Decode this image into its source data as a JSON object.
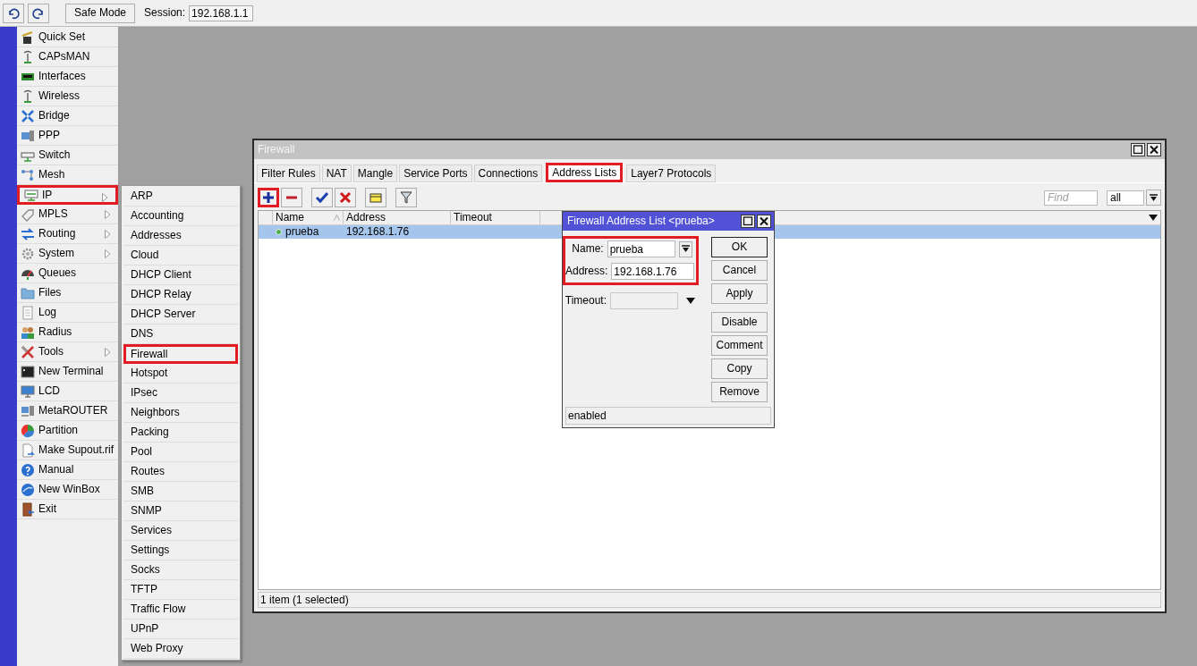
{
  "topbar": {
    "history_buttons": [
      {
        "kind": "undo"
      },
      {
        "kind": "redo"
      }
    ],
    "safe_mode": "Safe Mode",
    "session": {
      "label": "Session:",
      "value": "192.168.1.1"
    }
  },
  "sidebar": {
    "items": [
      {
        "label": "Quick Set",
        "has_submenu": false,
        "highlighted": false
      },
      {
        "label": "CAPsMAN",
        "has_submenu": false,
        "highlighted": false
      },
      {
        "label": "Interfaces",
        "has_submenu": false,
        "highlighted": false
      },
      {
        "label": "Wireless",
        "has_submenu": false,
        "highlighted": false
      },
      {
        "label": "Bridge",
        "has_submenu": false,
        "highlighted": false
      },
      {
        "label": "PPP",
        "has_submenu": false,
        "highlighted": false
      },
      {
        "label": "Switch",
        "has_submenu": false,
        "highlighted": false
      },
      {
        "label": "Mesh",
        "has_submenu": false,
        "highlighted": false
      },
      {
        "label": "IP",
        "has_submenu": true,
        "highlighted": true
      },
      {
        "label": "MPLS",
        "has_submenu": true,
        "highlighted": false
      },
      {
        "label": "Routing",
        "has_submenu": true,
        "highlighted": false
      },
      {
        "label": "System",
        "has_submenu": true,
        "highlighted": false
      },
      {
        "label": "Queues",
        "has_submenu": false,
        "highlighted": false
      },
      {
        "label": "Files",
        "has_submenu": false,
        "highlighted": false
      },
      {
        "label": "Log",
        "has_submenu": false,
        "highlighted": false
      },
      {
        "label": "Radius",
        "has_submenu": false,
        "highlighted": false
      },
      {
        "label": "Tools",
        "has_submenu": true,
        "highlighted": false
      },
      {
        "label": "New Terminal",
        "has_submenu": false,
        "highlighted": false
      },
      {
        "label": "LCD",
        "has_submenu": false,
        "highlighted": false
      },
      {
        "label": "MetaROUTER",
        "has_submenu": false,
        "highlighted": false
      },
      {
        "label": "Partition",
        "has_submenu": false,
        "highlighted": false
      },
      {
        "label": "Make Supout.rif",
        "has_submenu": false,
        "highlighted": false
      },
      {
        "label": "Manual",
        "has_submenu": false,
        "highlighted": false
      },
      {
        "label": "New WinBox",
        "has_submenu": false,
        "highlighted": false
      },
      {
        "label": "Exit",
        "has_submenu": false,
        "highlighted": false
      }
    ]
  },
  "submenu": {
    "items": [
      {
        "label": "ARP",
        "highlighted": false
      },
      {
        "label": "Accounting",
        "highlighted": false
      },
      {
        "label": "Addresses",
        "highlighted": false
      },
      {
        "label": "Cloud",
        "highlighted": false
      },
      {
        "label": "DHCP Client",
        "highlighted": false
      },
      {
        "label": "DHCP Relay",
        "highlighted": false
      },
      {
        "label": "DHCP Server",
        "highlighted": false
      },
      {
        "label": "DNS",
        "highlighted": false
      },
      {
        "label": "Firewall",
        "highlighted": true
      },
      {
        "label": "Hotspot",
        "highlighted": false
      },
      {
        "label": "IPsec",
        "highlighted": false
      },
      {
        "label": "Neighbors",
        "highlighted": false
      },
      {
        "label": "Packing",
        "highlighted": false
      },
      {
        "label": "Pool",
        "highlighted": false
      },
      {
        "label": "Routes",
        "highlighted": false
      },
      {
        "label": "SMB",
        "highlighted": false
      },
      {
        "label": "SNMP",
        "highlighted": false
      },
      {
        "label": "Services",
        "highlighted": false
      },
      {
        "label": "Settings",
        "highlighted": false
      },
      {
        "label": "Socks",
        "highlighted": false
      },
      {
        "label": "TFTP",
        "highlighted": false
      },
      {
        "label": "Traffic Flow",
        "highlighted": false
      },
      {
        "label": "UPnP",
        "highlighted": false
      },
      {
        "label": "Web Proxy",
        "highlighted": false
      }
    ]
  },
  "firewall_window": {
    "title": "Firewall",
    "tabs": [
      {
        "label": "Filter Rules",
        "selected": false,
        "highlighted": false
      },
      {
        "label": "NAT",
        "selected": false,
        "highlighted": false
      },
      {
        "label": "Mangle",
        "selected": false,
        "highlighted": false
      },
      {
        "label": "Service Ports",
        "selected": false,
        "highlighted": false
      },
      {
        "label": "Connections",
        "selected": false,
        "highlighted": false
      },
      {
        "label": "Address Lists",
        "selected": true,
        "highlighted": true
      },
      {
        "label": "Layer7 Protocols",
        "selected": false,
        "highlighted": false
      }
    ],
    "toolbar": [
      {
        "kind": "add",
        "highlighted": true
      },
      {
        "kind": "remove",
        "highlighted": false
      },
      {
        "kind": "enable",
        "highlighted": false
      },
      {
        "kind": "disable",
        "highlighted": false
      },
      {
        "kind": "comment",
        "highlighted": false
      },
      {
        "kind": "filter",
        "highlighted": false
      }
    ],
    "find": {
      "placeholder": "Find"
    },
    "filter_value": "all",
    "table": {
      "columns": [
        "Name",
        "Address",
        "Timeout"
      ],
      "rows": [
        {
          "cells": [
            "prueba",
            "192.168.1.76"
          ],
          "selected": true,
          "enabled": true
        }
      ]
    },
    "status": "1 item (1 selected)"
  },
  "dialog": {
    "title": "Firewall Address List <prueba>",
    "fields": [
      {
        "label": "Name:",
        "value": "prueba",
        "kind": "combo",
        "highlighted": true
      },
      {
        "label": "Address:",
        "value": "192.168.1.76",
        "kind": "text",
        "highlighted": true
      },
      {
        "label": "Timeout:",
        "kind": "dropdown",
        "highlighted": false
      }
    ],
    "button_groups": [
      [
        {
          "label": "OK",
          "default": true
        },
        {
          "label": "Cancel",
          "default": false
        },
        {
          "label": "Apply",
          "default": false
        }
      ],
      [
        {
          "label": "Disable",
          "default": false
        },
        {
          "label": "Comment",
          "default": false
        },
        {
          "label": "Copy",
          "default": false
        },
        {
          "label": "Remove",
          "default": false
        }
      ]
    ],
    "status": "enabled"
  }
}
